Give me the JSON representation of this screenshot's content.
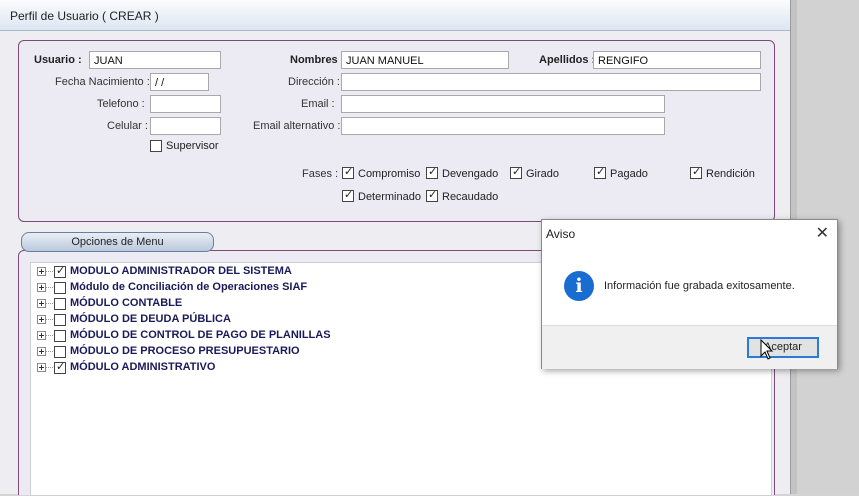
{
  "window": {
    "title": "Perfil de Usuario ( CREAR )"
  },
  "form": {
    "usuario_label": "Usuario :",
    "usuario_value": "JUAN",
    "nombres_label": "Nombres :",
    "nombres_value": "JUAN MANUEL",
    "apellidos_label": "Apellidos :",
    "apellidos_value": "RENGIFO",
    "fecha_label": "Fecha Nacimiento :",
    "fecha_value": "/ /",
    "direccion_label": "Dirección :",
    "direccion_value": "",
    "telefono_label": "Telefono :",
    "telefono_value": "",
    "email_label": "Email :",
    "email_value": "",
    "celular_label": "Celular :",
    "celular_value": "",
    "email_alt_label": "Email alternativo :",
    "email_alt_value": "",
    "supervisor_label": "Supervisor",
    "supervisor_checked": false,
    "fases_label": "Fases :",
    "fases": [
      {
        "label": "Compromiso",
        "checked": true
      },
      {
        "label": "Devengado",
        "checked": true
      },
      {
        "label": "Girado",
        "checked": true
      },
      {
        "label": "Pagado",
        "checked": true
      },
      {
        "label": "Rendición",
        "checked": true
      },
      {
        "label": "Determinado",
        "checked": true
      },
      {
        "label": "Recaudado",
        "checked": true
      }
    ]
  },
  "menu": {
    "tab_label": "Opciones de Menu",
    "items": [
      {
        "label": "MODULO ADMINISTRADOR DEL SISTEMA",
        "checked": true
      },
      {
        "label": "Módulo de Conciliación de Operaciones SIAF",
        "checked": false
      },
      {
        "label": "MÓDULO CONTABLE",
        "checked": false
      },
      {
        "label": "MÓDULO DE DEUDA PÚBLICA",
        "checked": false
      },
      {
        "label": "MÓDULO DE CONTROL DE PAGO DE PLANILLAS",
        "checked": false
      },
      {
        "label": "MÓDULO DE PROCESO PRESUPUESTARIO",
        "checked": false
      },
      {
        "label": "MÓDULO ADMINISTRATIVO",
        "checked": true
      }
    ]
  },
  "dialog": {
    "title": "Aviso",
    "close_glyph": "✕",
    "icon_glyph": "i",
    "message": "Información fue grabada exitosamente.",
    "button_label": "Aceptar"
  }
}
